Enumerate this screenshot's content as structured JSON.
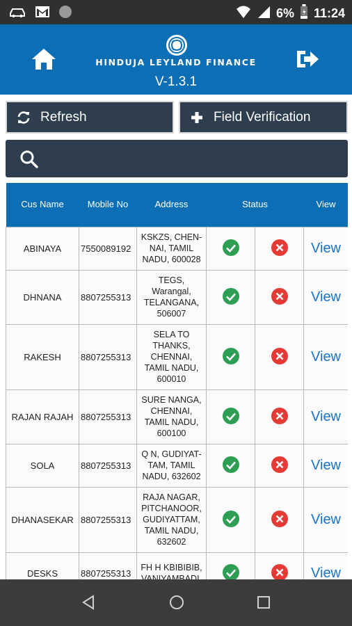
{
  "status_bar": {
    "battery": "6%",
    "time": "11:24",
    "icons": [
      "car-icon",
      "gmail-icon",
      "circle-icon",
      "wifi-icon",
      "signal-icon",
      "battery-icon"
    ]
  },
  "header": {
    "brand": "HINDUJA LEYLAND FINANCE",
    "version": "V-1.3.1",
    "home_icon": "home-icon",
    "logout_icon": "logout-icon",
    "background": "#0c6fb5"
  },
  "actions": {
    "refresh_label": "Refresh",
    "field_verification_label": "Field Verification",
    "button_color": "#2f3e4e"
  },
  "search": {
    "placeholder": "",
    "value": ""
  },
  "table": {
    "headers": {
      "name": "Cus Name",
      "mobile": "Mobile No",
      "address": "Address",
      "status": "Status",
      "view": "View"
    },
    "rows": [
      {
        "name": "ABINAYA",
        "mobile": "7550089192",
        "address": "KSKZS, CHEN-NAI, TAMIL NADU, 600028",
        "status_ok": true,
        "status_fail": true,
        "view": "View"
      },
      {
        "name": "DHNANA",
        "mobile": "8807255313",
        "address": "TEGS, Warangal, TELANGANA, 506007",
        "status_ok": true,
        "status_fail": true,
        "view": "View"
      },
      {
        "name": "RAKESH",
        "mobile": "8807255313",
        "address": "SELA  TO THANKS, CHENNAI, TAMIL NADU, 600010",
        "status_ok": true,
        "status_fail": true,
        "view": "View"
      },
      {
        "name": "RAJAN RAJAH",
        "mobile": "8807255313",
        "address": "SURE NANGA, CHENNAI, TAMIL NADU, 600100",
        "status_ok": true,
        "status_fail": true,
        "view": "View"
      },
      {
        "name": "SOLA",
        "mobile": "8807255313",
        "address": "Q N, GUDIYAT-TAM, TAMIL NADU, 632602",
        "status_ok": true,
        "status_fail": true,
        "view": "View"
      },
      {
        "name": "DHANASEKAR",
        "mobile": "8807255313",
        "address": "RAJA NAGAR, PITCHANOOR, GUDIYATTAM, TAMIL NADU, 632602",
        "status_ok": true,
        "status_fail": true,
        "view": "View"
      },
      {
        "name": "DESKS",
        "mobile": "8807255313",
        "address": "FH H KBIBIBIB, VANIYAMBADI,",
        "status_ok": true,
        "status_fail": true,
        "view": "View"
      }
    ],
    "ok_color": "#2e9e54",
    "fail_color": "#e53935"
  },
  "nav": {
    "back_icon": "back-icon",
    "home_icon": "home-circle-icon",
    "recent_icon": "recent-apps-icon"
  }
}
